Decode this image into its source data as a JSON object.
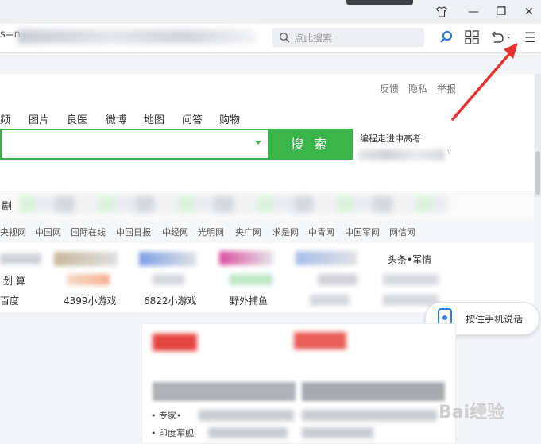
{
  "titlebar": {
    "shirt_icon": "shirt-icon",
    "minimize": "—",
    "restore": "❐",
    "close": "✕"
  },
  "toolbar": {
    "url_fragment": "s=n",
    "search_placeholder": "点此搜索",
    "menu_icon": "☰"
  },
  "page": {
    "top_links": [
      "反馈",
      "隐私",
      "举报"
    ],
    "tabs": [
      "频",
      "图片",
      "良医",
      "微博",
      "地图",
      "问答",
      "购物"
    ],
    "search_button": "搜 索",
    "hot_title": "编程走进中高考",
    "drama_label": "剧",
    "site_links": [
      "央视网",
      "中国网",
      "国际在线",
      "中国日报",
      "中经网",
      "光明网",
      "央广网",
      "求是网",
      "中青网",
      "中国军网",
      "网信网"
    ],
    "grid_row1": {
      "c5": "头条•军情"
    },
    "grid_row2": {
      "c1": "划 算"
    },
    "grid_row3": {
      "c1": "百度",
      "c2": "4399小游戏",
      "c3": "6822小游戏",
      "c4": "野外捕鱼"
    }
  },
  "voice": {
    "label": "按住手机说话"
  },
  "news": {
    "lines": [
      "• 专家•",
      "• 印度军舰"
    ]
  },
  "watermark": {
    "text": "Bai经验"
  },
  "colors": {
    "accent": "#3ab54a",
    "annotation": "#e8322f"
  }
}
